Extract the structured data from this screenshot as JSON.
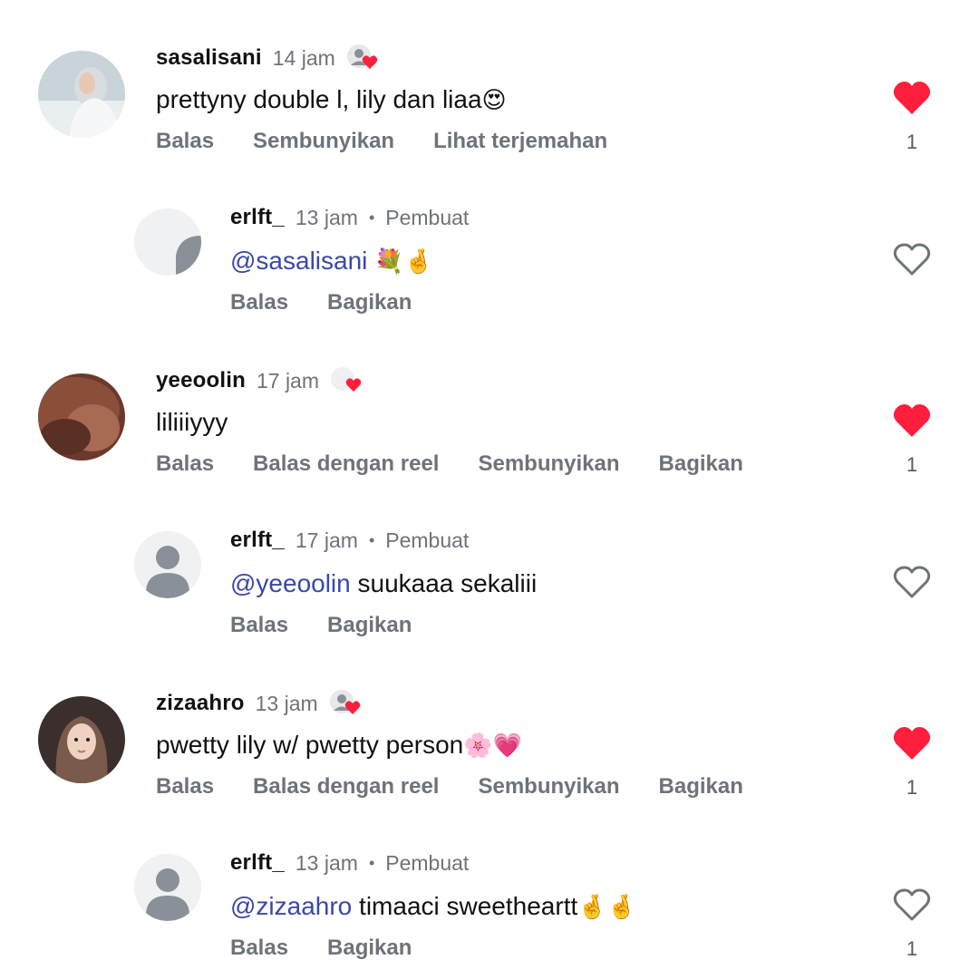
{
  "comments": [
    {
      "username": "sasalisani",
      "time": "14 jam",
      "creator_badge": "",
      "text": "prettyny double l, lily dan liaa",
      "emoji": "😍",
      "actions": [
        "Balas",
        "Sembunyikan",
        "Lihat terjemahan"
      ],
      "liked": true,
      "like_count": "1",
      "creator_liked": true,
      "avatar_icon": "profile-photo"
    },
    {
      "username": "erlft_",
      "time": "13 jam",
      "creator_badge": "Pembuat",
      "mention": "@sasalisani",
      "text": "",
      "emoji": "💐🤞",
      "actions": [
        "Balas",
        "Bagikan"
      ],
      "liked": false,
      "like_count": "",
      "creator_liked": false,
      "avatar_icon": "loading-avatar"
    },
    {
      "username": "yeeoolin",
      "time": "17 jam",
      "creator_badge": "",
      "text": "liliiiyyy",
      "emoji": "",
      "actions": [
        "Balas",
        "Balas dengan reel",
        "Sembunyikan",
        "Bagikan"
      ],
      "liked": true,
      "like_count": "1",
      "creator_liked": true,
      "avatar_icon": "profile-photo"
    },
    {
      "username": "erlft_",
      "time": "17 jam",
      "creator_badge": "Pembuat",
      "mention": "@yeeoolin",
      "text": " suukaaa sekaliii",
      "emoji": "",
      "actions": [
        "Balas",
        "Bagikan"
      ],
      "liked": false,
      "like_count": "",
      "creator_liked": false,
      "avatar_icon": "default-avatar"
    },
    {
      "username": "zizaahro",
      "time": "13 jam",
      "creator_badge": "",
      "text": "pwetty lily w/ pwetty person",
      "emoji": "🌸💗",
      "actions": [
        "Balas",
        "Balas dengan reel",
        "Sembunyikan",
        "Bagikan"
      ],
      "liked": true,
      "like_count": "1",
      "creator_liked": true,
      "avatar_icon": "profile-photo"
    },
    {
      "username": "erlft_",
      "time": "13 jam",
      "creator_badge": "Pembuat",
      "mention": "@zizaahro",
      "text": " timaaci sweetheartt",
      "emoji": "🤞🤞",
      "actions": [
        "Balas",
        "Bagikan"
      ],
      "liked": false,
      "like_count": "1",
      "creator_liked": false,
      "avatar_icon": "default-avatar"
    }
  ],
  "colors": {
    "like_red": "#ff1f3d",
    "mention_blue": "#3948a8",
    "meta_gray": "#6d737a"
  }
}
